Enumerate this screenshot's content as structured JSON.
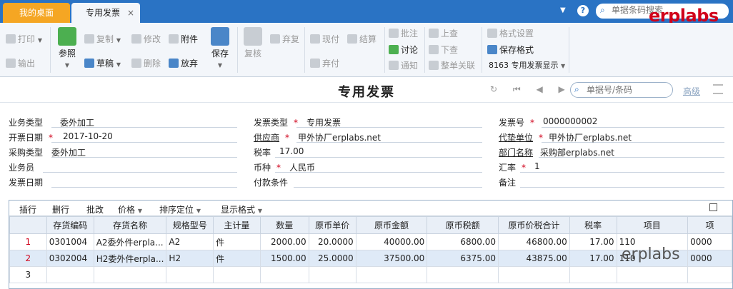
{
  "tabs": {
    "home": "我的桌面",
    "active": "专用发票",
    "close": "×"
  },
  "top_search": {
    "placeholder": "单据条码搜索"
  },
  "logo": "erplabs",
  "toolbar": {
    "print": "打印",
    "output": "输出",
    "refer": "参照",
    "copy": "复制",
    "draft": "草稿",
    "modify": "修改",
    "delete": "删除",
    "attach": "附件",
    "discard": "放弃",
    "save": "保存",
    "review": "复核",
    "abandon": "弃复",
    "cash": "现付",
    "settle": "结算",
    "abandon_pay": "弃付",
    "approve": "批注",
    "discuss": "讨论",
    "notify": "通知",
    "prev": "上查",
    "next": "下查",
    "whole": "整单关联",
    "format_setting": "格式设置",
    "save_format": "保存格式",
    "format_name": "8163 专用发票显示"
  },
  "title": "专用发票",
  "nav": "↻ ⏮ ◀ ▶ ⏭",
  "doc_search": {
    "placeholder": "单据号/条码"
  },
  "advanced": "高级",
  "form": {
    "business_type": {
      "label": "业务类型",
      "value": "委外加工"
    },
    "invoice_type": {
      "label": "发票类型",
      "value": "专用发票"
    },
    "invoice_no": {
      "label": "发票号",
      "value": "0000000002"
    },
    "open_date": {
      "label": "开票日期",
      "value": "2017-10-20"
    },
    "supplier": {
      "label": "供应商",
      "value": "甲外协厂erplabs.net"
    },
    "paying_unit": {
      "label": "代垫单位",
      "value": "甲外协厂erplabs.net"
    },
    "purchase_type": {
      "label": "采购类型",
      "value": "委外加工"
    },
    "tax_rate": {
      "label": "税率",
      "value": "17.00"
    },
    "department": {
      "label": "部门名称",
      "value": "采购部erplabs.net"
    },
    "clerk": {
      "label": "业务员",
      "value": ""
    },
    "currency": {
      "label": "币种",
      "value": "人民币"
    },
    "exchange_rate": {
      "label": "汇率",
      "value": "1"
    },
    "invoice_date": {
      "label": "发票日期",
      "value": ""
    },
    "payment_terms": {
      "label": "付款条件",
      "value": ""
    },
    "remark": {
      "label": "备注",
      "value": ""
    }
  },
  "grid_toolbar": {
    "insert": "插行",
    "delete": "删行",
    "batch": "批改",
    "price": "价格",
    "sort": "排序定位",
    "display": "显示格式"
  },
  "grid": {
    "columns": [
      "",
      "存货编码",
      "存货名称",
      "规格型号",
      "主计量",
      "数量",
      "原币单价",
      "原币金额",
      "原币税额",
      "原币价税合计",
      "税率",
      "项目",
      "项"
    ],
    "rows": [
      [
        "1",
        "0301004",
        "A2委外件erpla...",
        "A2",
        "件",
        "2000.00",
        "20.0000",
        "40000.00",
        "6800.00",
        "46800.00",
        "17.00",
        "110",
        "0000"
      ],
      [
        "2",
        "0302004",
        "H2委外件erpla...",
        "H2",
        "件",
        "1500.00",
        "25.0000",
        "37500.00",
        "6375.00",
        "43875.00",
        "17.00",
        "110",
        "0000"
      ],
      [
        "3",
        "",
        "",
        "",
        "",
        "",
        "",
        "",
        "",
        "",
        "",
        "",
        ""
      ]
    ]
  },
  "watermark": "erplabs",
  "colors": {
    "tabbar": "#2a73c4",
    "home_tab": "#f5a623",
    "logo": "#d0021b",
    "required": "#d0021b"
  }
}
